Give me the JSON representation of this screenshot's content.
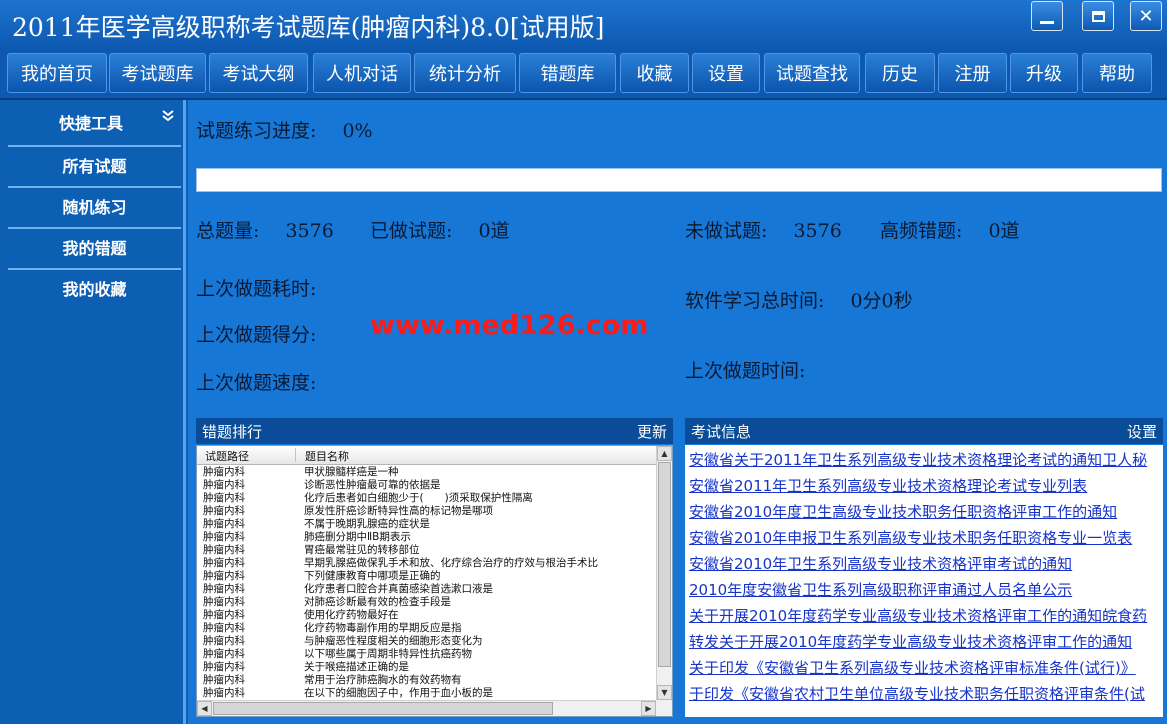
{
  "window": {
    "title": "2011年医学高级职称考试题库(肿瘤内科)8.0[试用版]",
    "minimize_icon": "minimize-icon",
    "maximize_icon": "maximize-icon",
    "close_icon": "close-icon"
  },
  "menu": [
    {
      "label": "我的首页"
    },
    {
      "label": "考试题库"
    },
    {
      "label": "考试大纲"
    },
    {
      "label": "人机对话"
    },
    {
      "label": "统计分析"
    },
    {
      "label": "错题库"
    },
    {
      "label": "收藏"
    },
    {
      "label": "设置"
    },
    {
      "label": "试题查找"
    },
    {
      "label": "历史"
    },
    {
      "label": "注册"
    },
    {
      "label": "升级"
    },
    {
      "label": "帮助"
    }
  ],
  "sidebar": {
    "header": "快捷工具",
    "header_icon": "double-chevron-down-icon",
    "items": [
      {
        "label": "所有试题"
      },
      {
        "label": "随机练习"
      },
      {
        "label": "我的错题"
      },
      {
        "label": "我的收藏"
      }
    ]
  },
  "stats": {
    "progress_label": "试题练习进度:",
    "progress_value": "0%",
    "progress_fraction": 0,
    "total_label": "总题量:",
    "total_value": "3576",
    "done_label": "已做试题:",
    "done_value": "0道",
    "undone_label": "未做试题:",
    "undone_value": "3576",
    "freq_wrong_label": "高频错题:",
    "freq_wrong_value": "0道",
    "last_time_label": "上次做题耗时:",
    "last_score_label": "上次做题得分:",
    "last_speed_label": "上次做题速度:",
    "total_study_label": "软件学习总时间:",
    "total_study_value": "0分0秒",
    "last_date_label": "上次做题时间:"
  },
  "watermark": "www.med126.com",
  "wrong_ranking": {
    "title": "错题排行",
    "update_label": "更新",
    "columns": [
      "试题路径",
      "题目名称"
    ],
    "rows": [
      [
        "肿瘤内科",
        "甲状腺髓样癌是一种"
      ],
      [
        "肿瘤内科",
        "诊断恶性肿瘤最可靠的依据是"
      ],
      [
        "肿瘤内科",
        "化疗后患者如白细胞少于(　　)须采取保护性隔离"
      ],
      [
        "肿瘤内科",
        "原发性肝癌诊断特异性高的标记物是哪项"
      ],
      [
        "肿瘤内科",
        "不属于晚期乳腺癌的症状是"
      ],
      [
        "肿瘤内科",
        "肺癌删分期中ⅡB期表示"
      ],
      [
        "肿瘤内科",
        "胃癌最常驻见的转移部位"
      ],
      [
        "肿瘤内科",
        "早期乳腺癌做保乳手术和放、化疗综合治疗的疗效与根治手术比"
      ],
      [
        "肿瘤内科",
        "下列健康教育中哪项是正确的"
      ],
      [
        "肿瘤内科",
        "化疗患者口腔合并真菌感染首选漱口液是"
      ],
      [
        "肿瘤内科",
        "对肺癌诊断最有效的检查手段是"
      ],
      [
        "肿瘤内科",
        "使用化疗药物最好在"
      ],
      [
        "肿瘤内科",
        "化疗药物毒副作用的早期反应是指"
      ],
      [
        "肿瘤内科",
        "与肿瘤恶性程度相关的细胞形态变化为"
      ],
      [
        "肿瘤内科",
        "以下哪些属于周期非特异性抗癌药物"
      ],
      [
        "肿瘤内科",
        "关于喉癌描述正确的是"
      ],
      [
        "肿瘤内科",
        "常用于治疗肺癌胸水的有效药物有"
      ],
      [
        "肿瘤内科",
        "在以下的细胞因子中，作用于血小板的是"
      ]
    ]
  },
  "exam_info": {
    "title": "考试信息",
    "settings_label": "设置",
    "items": [
      "安徽省关于2011年卫生系列高级专业技术资格理论考试的通知卫人秘",
      "安徽省2011年卫生系列高级专业技术资格理论考试专业列表",
      "安徽省2010年度卫生高级专业技术职务任职资格评审工作的通知",
      "安徽省2010年申报卫生系列高级专业技术职务任职资格专业一览表",
      "安徽省2010年卫生系列高级专业技术资格评审考试的通知",
      "2010年度安徽省卫生系列高级职称评审通过人员名单公示",
      "关于开展2010年度药学专业高级专业技术资格评审工作的通知皖食药",
      "转发关于开展2010年度药学专业高级专业技术资格评审工作的通知",
      "关于印发《安徽省卫生系列高级专业技术资格评审标准条件(试行)》",
      "于印发《安徽省农村卫生单位高级专业技术职务任职资格评审条件(试"
    ]
  }
}
